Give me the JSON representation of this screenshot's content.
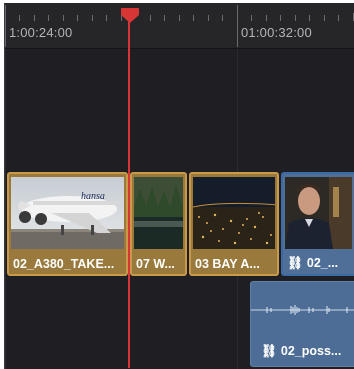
{
  "ruler": {
    "timecode_1": "1:00:24:00",
    "timecode_2": "01:00:32:00"
  },
  "video_track": {
    "clips": [
      {
        "label": "02_A380_TAKE..."
      },
      {
        "label": "07 W..."
      },
      {
        "label": "03 BAY A..."
      },
      {
        "label": "02_..."
      }
    ]
  },
  "audio_track": {
    "clip_label": "02_poss..."
  },
  "colors": {
    "clip_selected_border": "#c89a4a",
    "clip_selected_fill": "#9a7a3c",
    "clip_linked_fill": "#4f6f98",
    "playhead": "#d73636",
    "timeline_bg": "#202024"
  }
}
